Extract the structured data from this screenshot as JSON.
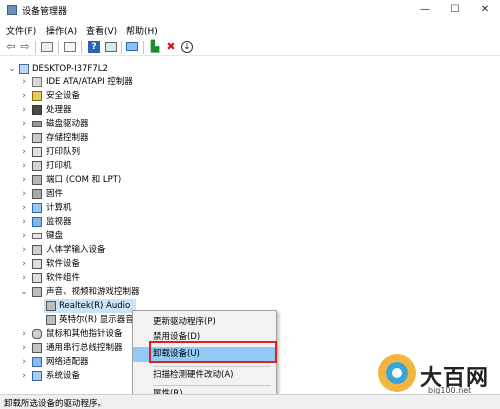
{
  "window": {
    "title": "设备管理器",
    "minimize_glyph": "—",
    "maximize_glyph": "☐",
    "close_glyph": "✕"
  },
  "menu": [
    "文件(F)",
    "操作(A)",
    "查看(V)",
    "帮助(H)"
  ],
  "toolbar_icons": [
    "back-arrow-icon",
    "forward-arrow-icon",
    "properties-icon",
    "list-icon",
    "help-icon",
    "console-icon",
    "monitor-icon",
    "add-driver-icon",
    "uninstall-x-icon",
    "download-icon"
  ],
  "tree": {
    "root": "DESKTOP-I37F7L2",
    "categories": [
      "IDE ATA/ATAPI 控制器",
      "安全设备",
      "处理器",
      "磁盘驱动器",
      "存储控制器",
      "打印队列",
      "打印机",
      "端口 (COM 和 LPT)",
      "固件",
      "计算机",
      "监视器",
      "键盘",
      "人体学输入设备",
      "软件设备",
      "软件组件",
      "声音、视频和游戏控制器"
    ],
    "audio_children": [
      "Realtek(R) Audio",
      "英特尔(R) 显示器音"
    ],
    "after_audio": [
      "鼠标和其他指针设备",
      "通用串行总线控制器",
      "网络适配器",
      "系统设备"
    ]
  },
  "context_menu": {
    "items": [
      "更新驱动程序(P)",
      "禁用设备(D)",
      "卸载设备(U)",
      "扫描检测硬件改动(A)",
      "属性(R)"
    ],
    "highlighted": "卸载设备(U)"
  },
  "status_bar": "卸载所选设备的驱动程序。",
  "watermark": {
    "title": "大百网",
    "sub": "big100.net"
  },
  "colors": {
    "selection": "#cce4f7",
    "menu_highlight": "#91c9f7",
    "annotation_box": "#e02020"
  }
}
